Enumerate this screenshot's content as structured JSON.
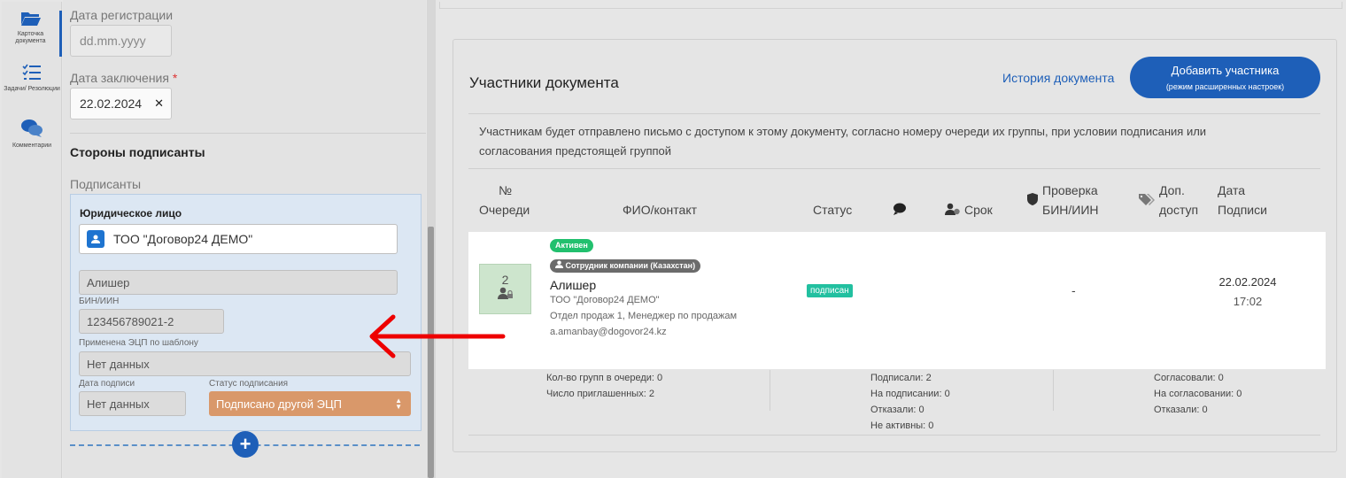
{
  "sidebar": {
    "items": [
      {
        "label": "Карточка документа",
        "icon": "folder-open-icon"
      },
      {
        "label": "Задачи/ Резолюции",
        "icon": "task-list-icon"
      },
      {
        "label": "Комментарии",
        "icon": "comments-icon"
      }
    ]
  },
  "form": {
    "reg_date_label": "Дата регистрации",
    "reg_date_placeholder": "dd.mm.yyyy",
    "conclusion_date_label": "Дата заключения",
    "required_mark": "*",
    "conclusion_date_value": "22.02.2024",
    "clear_icon": "✕",
    "section_title": "Стороны подписанты",
    "signers_label": "Подписанты"
  },
  "signer_card": {
    "title": "Юридическое лицо",
    "company": "ТОО \"Договор24 ДЕМО\"",
    "person": "Алишер",
    "bin_label": "БИН/ИИН",
    "bin_value": "123456789021-2",
    "ecp_template_label": "Применена ЭЦП по шаблону",
    "ecp_template_value": "Нет данных",
    "sign_date_label": "Дата подписи",
    "sign_date_value": "Нет данных",
    "sign_status_label": "Статус подписания",
    "sign_status_value": "Подписано другой ЭЦП",
    "add_icon": "+"
  },
  "participants": {
    "title": "Участники документа",
    "history_link": "История документа",
    "add_button_line1": "Добавить участника",
    "add_button_line2": "(режим расширенных настроек)",
    "notice": "Участникам будет отправлено письмо с доступом к этому документу, согласно номеру очереди их группы, при условии подписания или согласования предстоящей группой",
    "columns": {
      "queue_1": "№",
      "queue_2": "Очереди",
      "fio": "ФИО/контакт",
      "status": "Статус",
      "deadline": "Срок",
      "check_1": "Проверка",
      "check_2": "БИН/ИИН",
      "access_1": "Доп.",
      "access_2": "доступ",
      "date_1": "Дата",
      "date_2": "Подписи"
    },
    "row": {
      "queue": "2",
      "active_badge": "Активен",
      "role_badge": "Сотрудник компании (Казахстан)",
      "name": "Алишер",
      "company": "ТОО \"Договор24 ДЕМО\"",
      "position": "Отдел продаж 1, Менеджер по продажам",
      "email": "a.amanbay@dogovor24.kz",
      "status": "подписан",
      "bin_check": "-",
      "date": "22.02.2024",
      "time": "17:02"
    },
    "stats": {
      "groups": "Кол-во групп в очереди: 0",
      "invited": "Число приглашенных: 2",
      "signed": "Подписали: 2",
      "on_sign": "На подписании: 0",
      "refused": "Отказали: 0",
      "inactive": "Не активны: 0",
      "agreed": "Согласовали: 0",
      "on_agree": "На согласовании: 0",
      "refused2": "Отказали: 0"
    }
  },
  "colors": {
    "accent": "#1e5fb8",
    "active_green": "#22c06e",
    "signed_teal": "#22c0a0",
    "select_orange": "#d9986a",
    "arrow_red": "#ee0000"
  }
}
